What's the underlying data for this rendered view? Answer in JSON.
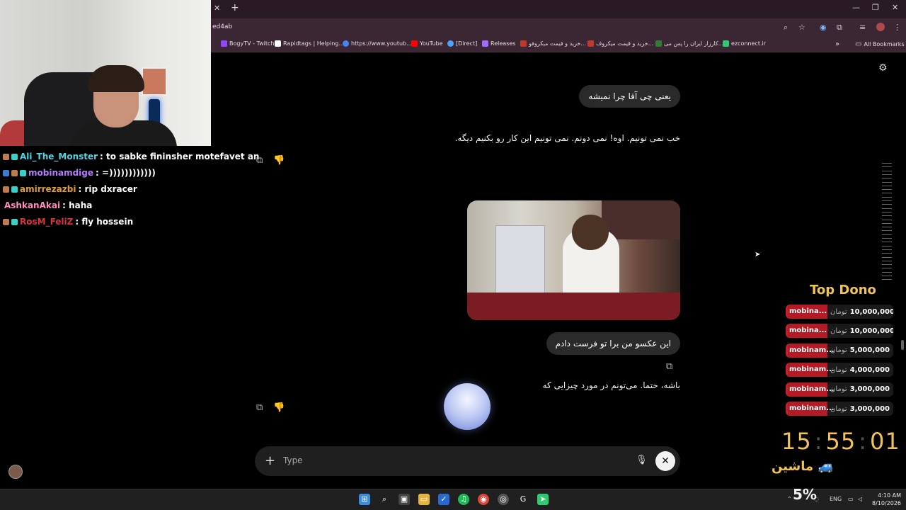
{
  "browser": {
    "tab_close_icon": "close-icon",
    "new_tab_icon": "plus-icon",
    "url_fragment": "ed4ab",
    "bookmarks": [
      {
        "label": "BogyTV - Twitch",
        "color": "#9146ff"
      },
      {
        "label": "Rapidtags | Helping...",
        "color": "#ffffff"
      },
      {
        "label": "https://www.youtub...",
        "color": "#4285f4"
      },
      {
        "label": "YouTube",
        "color": "#ff0000"
      },
      {
        "label": "[Direct]",
        "color": "#4aa3ff"
      },
      {
        "label": "Releases",
        "color": "#a06cff"
      },
      {
        "label": "خرید و قیمت میکروفو...",
        "color": "#c0392b"
      },
      {
        "label": "خرید و قیمت میکروف...",
        "color": "#c0392b"
      },
      {
        "label": "کارزار ایران را پس می...",
        "color": "#2e7d32"
      },
      {
        "label": "ezconnect.ir",
        "color": "#2ecc71"
      }
    ],
    "all_bookmarks": "All Bookmarks"
  },
  "chat": [
    {
      "user": "Ali_The_Monster",
      "color": "#4fd6e6",
      "msg": "to sabke fininsher motefavet an"
    },
    {
      "user": "mobinamdige",
      "color": "#b27cff",
      "msg": "=))))))))))))"
    },
    {
      "user": "amirrezazbi",
      "color": "#e0a030",
      "msg": "rip dxracer"
    },
    {
      "user": "AshkanAkai",
      "color": "#ff8ac0",
      "msg": "haha"
    },
    {
      "user": "RosM_FeliZ",
      "color": "#e03040",
      "msg": "fly hossein"
    }
  ],
  "conversation": {
    "user_msg_1": "یعنی چی آقا چرا نمیشه",
    "ai_msg_1": "خب نمی تونیم. اوه! نمی دونم. نمی تونیم این کار رو بکنیم دیگه.",
    "user_msg_2": "این عکسو من برا تو فرست دادم",
    "ai_msg_2": "باشه، حتما. می‌تونم در مورد چیزایی که",
    "input_placeholder": "Type"
  },
  "top_dono": {
    "title": "Top Dono",
    "currency": "تومان",
    "rows": [
      {
        "name": "mobina...",
        "amount": "10,000,000"
      },
      {
        "name": "mobina...",
        "amount": "10,000,000"
      },
      {
        "name": "mobinam...",
        "amount": "5,000,000"
      },
      {
        "name": "mobinam...",
        "amount": "4,000,000"
      },
      {
        "name": "mobinam...",
        "amount": "3,000,000"
      },
      {
        "name": "mobinam...",
        "amount": "3,000,000"
      }
    ]
  },
  "overlay": {
    "clock_h": "15",
    "clock_m": "55",
    "clock_s": "01",
    "clock_sep": ":",
    "vehicle_label": "ماشین",
    "percent": "5%"
  },
  "taskbar": {
    "lang": "ENG",
    "time": "4:10 AM",
    "date": "8/10/2026"
  }
}
